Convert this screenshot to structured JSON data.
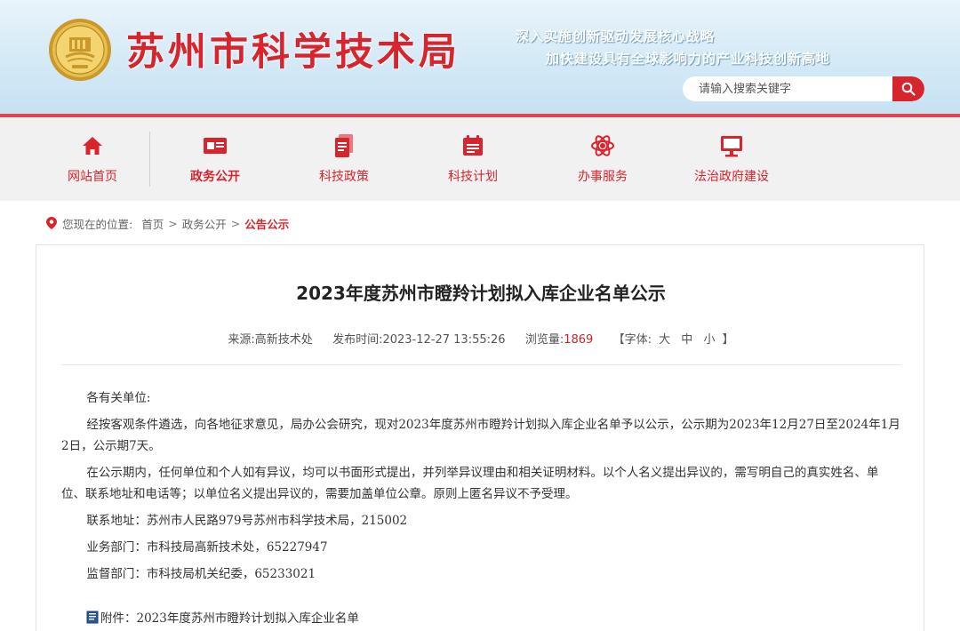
{
  "header": {
    "title": "苏州市科学技术局",
    "slogan_line1": "深入实施创新驱动发展核心战略",
    "slogan_line2": "加快建设具有全球影响力的产业科技创新高地",
    "search_placeholder": "请输入搜索关键字",
    "logo_icon": "city-emblem-icon"
  },
  "nav": {
    "items": [
      {
        "label": "网站首页",
        "icon": "home-icon"
      },
      {
        "label": "政务公开",
        "icon": "id-card-icon"
      },
      {
        "label": "科技政策",
        "icon": "document-icon"
      },
      {
        "label": "科技计划",
        "icon": "calendar-icon"
      },
      {
        "label": "办事服务",
        "icon": "atom-icon"
      },
      {
        "label": "法治政府建设",
        "icon": "monitor-icon"
      }
    ],
    "active_index": 1
  },
  "breadcrumb": {
    "prefix": "您现在的位置:",
    "items": [
      "首页",
      "政务公开",
      "公告公示"
    ],
    "separator": ">"
  },
  "article": {
    "title": "2023年度苏州市瞪羚计划拟入库企业名单公示",
    "meta": {
      "source_label": "来源:",
      "source": "高新技术处",
      "time_label": "发布时间:",
      "time": "2023-12-27 13:55:26",
      "views_label": "浏览量:",
      "views": "1869",
      "font_label_open": "【字体:",
      "font_large": "大",
      "font_medium": "中",
      "font_small": "小",
      "font_label_close": "】"
    },
    "paragraphs": [
      "各有关单位:",
      "经按客观条件遴选，向各地征求意见，局办公会研究，现对2023年度苏州市瞪羚计划拟入库企业名单予以公示，公示期为2023年12月27日至2024年1月2日，公示期7天。",
      "在公示期内，任何单位和个人如有异议，均可以书面形式提出，并列举异议理由和相关证明材料。以个人名义提出异议的，需写明自己的真实姓名、单位、联系地址和电话等；以单位名义提出异议的，需要加盖单位公章。原则上匿名异议不予受理。",
      "联系地址：苏州市人民路979号苏州市科学技术局，215002",
      "业务部门：市科技局高新技术处，65227947",
      "监督部门：市科技局机关纪委，65233021"
    ],
    "attachment": "附件：2023年度苏州市瞪羚计划拟入库企业名单"
  },
  "colors": {
    "brand_red": "#d7252e",
    "nav_bg": "#f1f1f1",
    "header_blue": "#d3e9f6"
  }
}
